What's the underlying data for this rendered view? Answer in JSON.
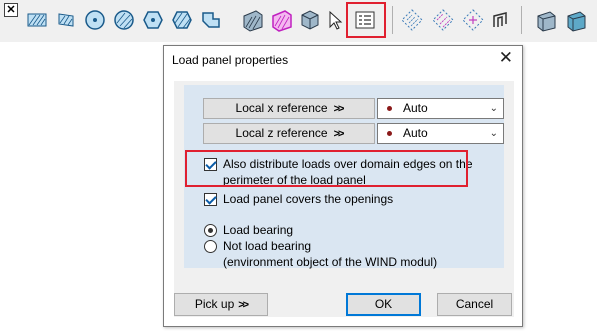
{
  "toolbar": {
    "close_label": "✕",
    "highlight_color": "#e02030",
    "icons": [
      "hatched-rectangle-icon",
      "hatched-parallelogram-icon",
      "circle-domain-icon",
      "circle-domain-2-icon",
      "hexagon-domain-icon",
      "hexagon-domain-2-icon",
      "polygon-domain-icon",
      "shaded-box-icon",
      "magenta-box-icon",
      "faceted-solid-icon",
      "select-pointer-icon",
      "load-panel-properties-icon",
      "dotted-rhombus-icon",
      "dotted-rhombus-2-icon",
      "dotted-rhombus-arrows-icon",
      "frame-gate-icon",
      "box-3d-icon",
      "box-3d-2-icon"
    ]
  },
  "dialog": {
    "title": "Load panel properties",
    "close_label": "✕",
    "local_x_label": "Local x reference",
    "local_x_value": "Auto",
    "local_z_label": "Local z reference",
    "local_z_value": "Auto",
    "distribute_line1": "Also distribute loads over domain edges on the",
    "distribute_line2": "perimeter of the load panel",
    "distribute_checked": true,
    "covers_openings_label": "Load panel covers the openings",
    "covers_openings_checked": true,
    "load_bearing_label": "Load bearing",
    "not_load_bearing_line1": "Not load bearing",
    "not_load_bearing_line2": "(environment object of the WIND modul)",
    "selected_option": "Load bearing",
    "pickup_label": "Pick up",
    "ok_label": "OK",
    "cancel_label": "Cancel"
  }
}
